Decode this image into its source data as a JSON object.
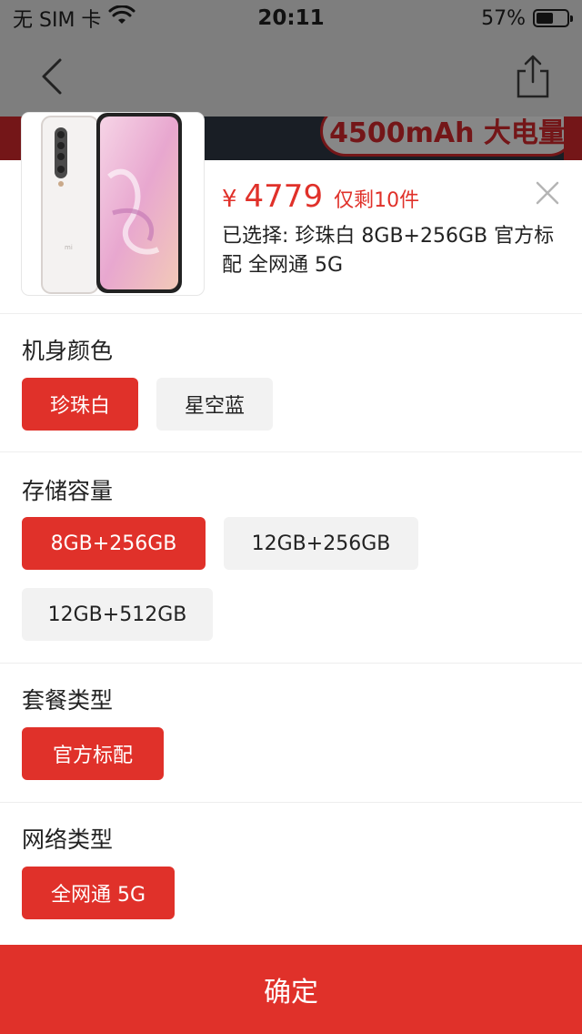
{
  "status_bar": {
    "carrier": "无 SIM 卡",
    "time": "20:11",
    "battery": "57%",
    "battery_level": 0.57
  },
  "banner": {
    "text": "4500mAh 大电量"
  },
  "sheet": {
    "price_symbol": "¥",
    "price": "4779",
    "stock": "仅剩10件",
    "selected": "已选择: 珍珠白 8GB+256GB 官方标配 全网通 5G",
    "color": {
      "title": "机身颜色",
      "options": [
        "珍珠白",
        "星空蓝"
      ]
    },
    "storage": {
      "title": "存储容量",
      "options": [
        "8GB+256GB",
        "12GB+256GB",
        "12GB+512GB"
      ]
    },
    "package": {
      "title": "套餐类型",
      "options": [
        "官方标配"
      ]
    },
    "network": {
      "title": "网络类型",
      "options": [
        "全网通 5G"
      ]
    },
    "confirm_label": "确定"
  },
  "colors": {
    "accent": "#e0312a",
    "chip_bg": "#f2f2f2"
  },
  "icons": [
    "wifi-icon",
    "battery-icon",
    "back-icon",
    "share-icon",
    "close-icon"
  ]
}
